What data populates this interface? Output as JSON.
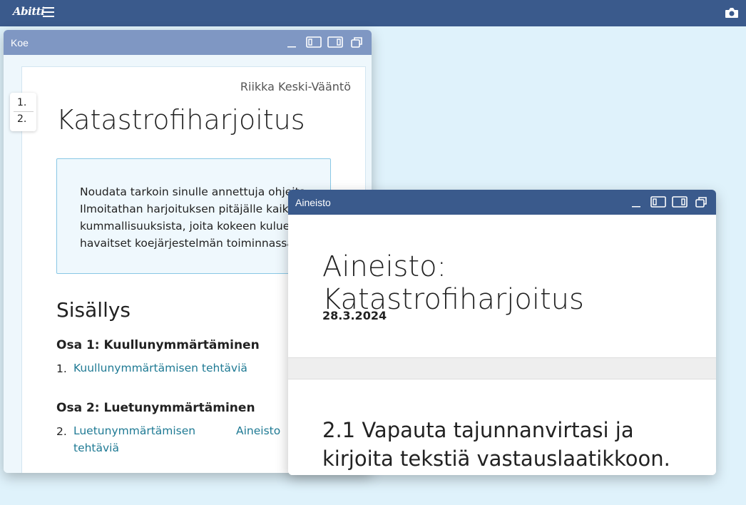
{
  "topbar": {
    "logo_text": "Abitti",
    "icons": [
      "hamburger-menu-icon",
      "camera-icon"
    ]
  },
  "koe_window": {
    "title": "Koe",
    "author": "Riikka Keski-Vääntö",
    "exam_title": "Katastrofiharjoitus",
    "instructions": [
      "Noudata tarkoin sinulle annettuja ohjeita.",
      "Ilmoitathan harjoituksen pitäjälle kaikista",
      "kummallisuuksista, joita kokeen kuluessa",
      "havaitset koejärjestelmän toiminnassa."
    ],
    "question_nav": [
      "1.",
      "2."
    ],
    "toc_title": "Sisällys",
    "parts": [
      {
        "title": "Osa 1: Kuullunymmärtäminen",
        "num": "1.",
        "link_lines": [
          "Kuullunymmärtämisen tehtäviä"
        ]
      },
      {
        "title": "Osa 2: Luetunymmärtäminen",
        "num": "2.",
        "link_lines": [
          "Luetunymmärtämisen",
          "tehtäviä"
        ],
        "extra_link": "Aineisto"
      }
    ]
  },
  "aineisto_window": {
    "title": "Aineisto",
    "heading": "Aineisto: Katastrofiharjoitus",
    "date": "28.3.2024",
    "task_lines": [
      "2.1 Vapauta tajunnanvirtasi ja",
      "kirjoita tekstiä vastauslaatikkoon."
    ]
  },
  "colors": {
    "topbar": "#3a5a8c",
    "koe_titlebar": "#7f97c3",
    "link": "#1f7a94",
    "background": "#dff2fb"
  }
}
